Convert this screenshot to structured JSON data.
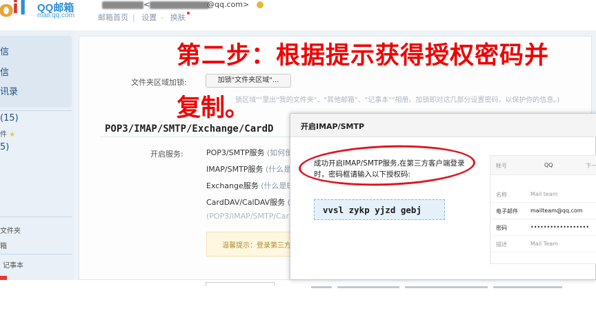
{
  "header": {
    "logo_brand": "QQ邮箱",
    "logo_domain": "mail.qq.com",
    "user_email_suffix": "@qq.com>",
    "nav": [
      "邮箱首页",
      "设置",
      "换肤"
    ]
  },
  "sidebar": {
    "items": [
      "信",
      "信",
      "讯录"
    ],
    "counts": [
      "(15)",
      "件",
      "5)"
    ],
    "lower": [
      "文件夹",
      "箱",
      "记事本"
    ]
  },
  "settings": {
    "folder_label": "文件夹区域加锁:",
    "folder_button": "加锁\"文件夹区域\"...",
    "folder_hint": "锁区域\"\"里出\"我的文件夹\"、\"其他邮箱\"、\"记事本\"\"相册。加锁即对这几部分设置密码，以保护你的信息。)",
    "section_title": "POP3/IMAP/SMTP/Exchange/CardD",
    "service_label": "开启服务:",
    "services": [
      {
        "name": "POP3/SMTP服务",
        "hint": "(如何使"
      },
      {
        "name": "IMAP/SMTP服务",
        "hint": "(什么是"
      },
      {
        "name": "Exchange服务",
        "hint": "(什么是E"
      },
      {
        "name": "CardDAV/CalDAV服务",
        "hint": "("
      }
    ],
    "services_note": "(POP3/IMAP/SMTP/Car",
    "tip": "温馨提示：登录第三方"
  },
  "caption": {
    "line1": "第二步：根据提示获得授权密码并",
    "line2": "复制。"
  },
  "dialog": {
    "title": "开启IMAP/SMTP",
    "message": "成功开启IMAP/SMTP服务,在第三方客户端登录时，密码框请输入以下授权码:",
    "auth_code": "vvsl zykp yjzd gebj",
    "preview": {
      "tabs": [
        "帐号",
        "QQ",
        "下一"
      ],
      "rows": [
        {
          "key": "名称",
          "value": "Mail team"
        },
        {
          "key": "电子邮件",
          "value": "mailteam@qq.com"
        },
        {
          "key": "密码",
          "value": "••••••••••••••••••"
        },
        {
          "key": "描述",
          "value": "Mail Team"
        }
      ]
    }
  },
  "colors": {
    "annotation_red": "#f00000",
    "oval_red": "#e0141e",
    "code_box_bg": "#e4f1fb",
    "brand_blue": "#2c8fd6"
  }
}
